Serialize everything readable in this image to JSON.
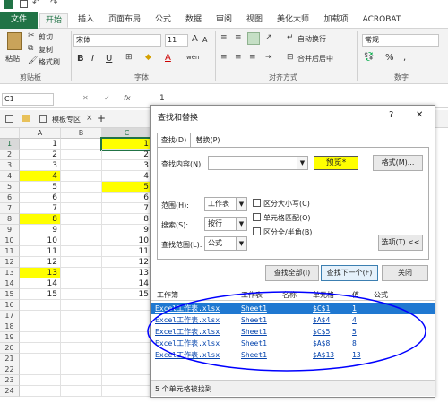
{
  "ribbon_tabs": [
    "文件",
    "开始",
    "插入",
    "页面布局",
    "公式",
    "数据",
    "审阅",
    "视图",
    "美化大师",
    "加载项",
    "ACROBAT"
  ],
  "clipboard": {
    "paste": "粘贴",
    "cut": "剪切",
    "copy": "复制",
    "format_painter": "格式刷",
    "group": "剪贴板"
  },
  "font": {
    "name": "宋体",
    "size": "11",
    "bold": "B",
    "italic": "I",
    "underline": "U",
    "grow": "A",
    "shrink": "A",
    "color_letter": "A",
    "wen": "wén",
    "group": "字体"
  },
  "align": {
    "wrap": "自动换行",
    "merge": "合并后居中",
    "group": "对齐方式"
  },
  "number": {
    "format": "常规",
    "pct": "%",
    "comma": ",",
    "group": "数字"
  },
  "formula_bar": {
    "name_box": "C1",
    "cancel": "✕",
    "enter": "✓",
    "fx": "fx",
    "value": "1"
  },
  "sheet_bar": {
    "template_tab": "模板专区",
    "add": "+"
  },
  "grid": {
    "col_headers": [
      "A",
      "B",
      "C"
    ],
    "rows": [
      {
        "num": "1",
        "a": "1",
        "c": "1",
        "ya": false,
        "yc": true
      },
      {
        "num": "2",
        "a": "2",
        "c": "2",
        "ya": false,
        "yc": false
      },
      {
        "num": "3",
        "a": "3",
        "c": "3",
        "ya": false,
        "yc": false
      },
      {
        "num": "4",
        "a": "4",
        "c": "4",
        "ya": true,
        "yc": false
      },
      {
        "num": "5",
        "a": "5",
        "c": "5",
        "ya": false,
        "yc": true
      },
      {
        "num": "6",
        "a": "6",
        "c": "6",
        "ya": false,
        "yc": false
      },
      {
        "num": "7",
        "a": "7",
        "c": "7",
        "ya": false,
        "yc": false
      },
      {
        "num": "8",
        "a": "8",
        "c": "8",
        "ya": true,
        "yc": false
      },
      {
        "num": "9",
        "a": "9",
        "c": "9",
        "ya": false,
        "yc": false
      },
      {
        "num": "10",
        "a": "10",
        "c": "10",
        "ya": false,
        "yc": false
      },
      {
        "num": "11",
        "a": "11",
        "c": "11",
        "ya": false,
        "yc": false
      },
      {
        "num": "12",
        "a": "12",
        "c": "12",
        "ya": false,
        "yc": false
      },
      {
        "num": "13",
        "a": "13",
        "c": "13",
        "ya": true,
        "yc": false
      },
      {
        "num": "14",
        "a": "14",
        "c": "14",
        "ya": false,
        "yc": false
      },
      {
        "num": "15",
        "a": "15",
        "c": "15",
        "ya": false,
        "yc": false
      },
      {
        "num": "16",
        "a": "",
        "c": "",
        "ya": false,
        "yc": false
      },
      {
        "num": "17",
        "a": "",
        "c": "",
        "ya": false,
        "yc": false
      },
      {
        "num": "18",
        "a": "",
        "c": "",
        "ya": false,
        "yc": false
      },
      {
        "num": "19",
        "a": "",
        "c": "",
        "ya": false,
        "yc": false
      },
      {
        "num": "20",
        "a": "",
        "c": "",
        "ya": false,
        "yc": false
      },
      {
        "num": "21",
        "a": "",
        "c": "",
        "ya": false,
        "yc": false
      },
      {
        "num": "22",
        "a": "",
        "c": "",
        "ya": false,
        "yc": false
      },
      {
        "num": "23",
        "a": "",
        "c": "",
        "ya": false,
        "yc": false
      },
      {
        "num": "24",
        "a": "",
        "c": "",
        "ya": false,
        "yc": false
      }
    ]
  },
  "dialog": {
    "title": "查找和替换",
    "help": "?",
    "close": "✕",
    "tab_find": "查找(D)",
    "tab_replace": "替换(P)",
    "find_label": "查找内容(N):",
    "preview": "预览*",
    "format_btn": "格式(M)...",
    "within_label": "范围(H):",
    "within_value": "工作表",
    "search_label": "搜索(S):",
    "search_value": "按行",
    "lookin_label": "查找范围(L):",
    "lookin_value": "公式",
    "match_case": "区分大小写(C)",
    "match_cell": "单元格匹配(O)",
    "match_width": "区分全/半角(B)",
    "options_btn": "选项(T) <<",
    "find_all": "查找全部(I)",
    "find_next": "查找下一个(F)",
    "close_btn": "关闭",
    "result_headers": [
      "工作簿",
      "工作表",
      "名称",
      "单元格",
      "值",
      "公式"
    ],
    "results": [
      {
        "book": "Excel工作表.xlsx",
        "sheet": "Sheet1",
        "cell": "$C$1",
        "value": "1"
      },
      {
        "book": "Excel工作表.xlsx",
        "sheet": "Sheet1",
        "cell": "$A$4",
        "value": "4"
      },
      {
        "book": "Excel工作表.xlsx",
        "sheet": "Sheet1",
        "cell": "$C$5",
        "value": "5"
      },
      {
        "book": "Excel工作表.xlsx",
        "sheet": "Sheet1",
        "cell": "$A$8",
        "value": "8"
      },
      {
        "book": "Excel工作表.xlsx",
        "sheet": "Sheet1",
        "cell": "$A$13",
        "value": "13"
      }
    ],
    "status": "5 个单元格被找到"
  },
  "colors": {
    "excel_green": "#217346",
    "highlight": "#ffff00",
    "selection": "#1f78d1",
    "annotation": "#0000ff"
  }
}
